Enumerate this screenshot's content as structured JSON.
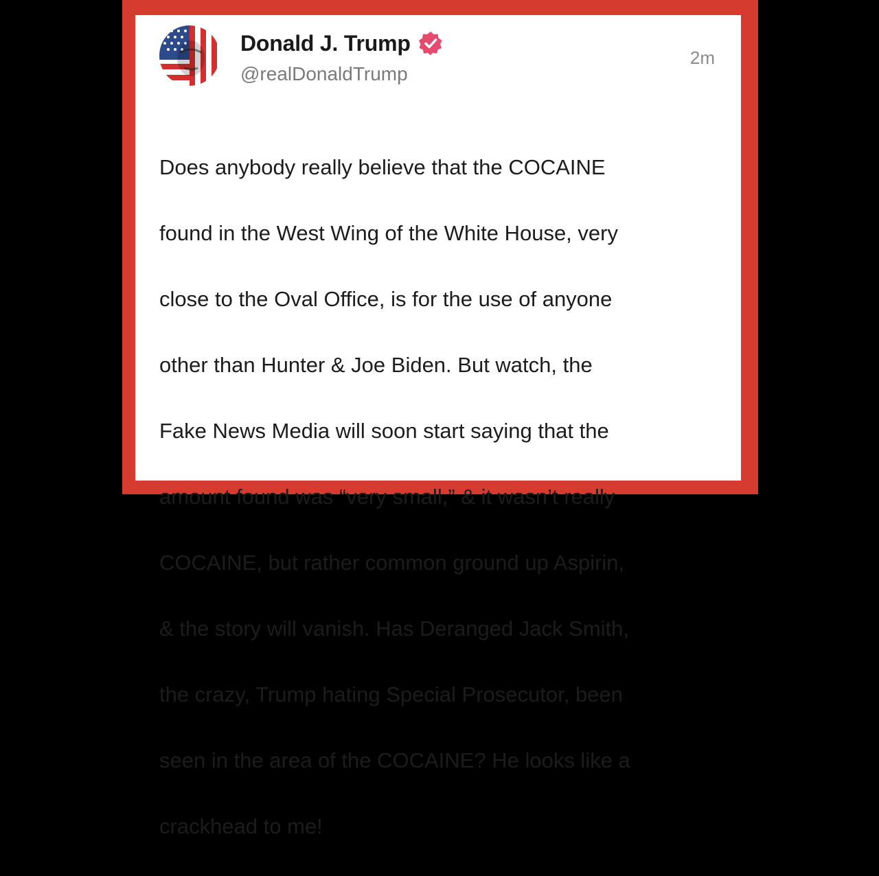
{
  "colors": {
    "frame": "#d63b30",
    "card": "#ffffff",
    "verified_badge": "#e64a6e",
    "text": "#1c1c1c",
    "muted": "#7a7a7a"
  },
  "author": {
    "display_name": "Donald J. Trump",
    "handle": "@realDonaldTrump",
    "verified_icon": "verified-badge-icon",
    "avatar_icon": "flag-portrait-avatar"
  },
  "post": {
    "timestamp": "2m",
    "lines": [
      "Does anybody really believe that the COCAINE",
      "found in the West Wing of the White House, very",
      "close to the Oval Office, is for the use of anyone",
      "other than Hunter & Joe Biden. But watch, the",
      "Fake News Media will soon start saying that the",
      "amount found was “very small,” & it wasn’t really",
      "COCAINE, but rather common ground up Aspirin,",
      "& the story will vanish. Has Deranged Jack Smith,",
      "the crazy, Trump hating Special Prosecutor, been",
      "seen in the area of the COCAINE? He looks like a",
      "crackhead to me!"
    ]
  }
}
